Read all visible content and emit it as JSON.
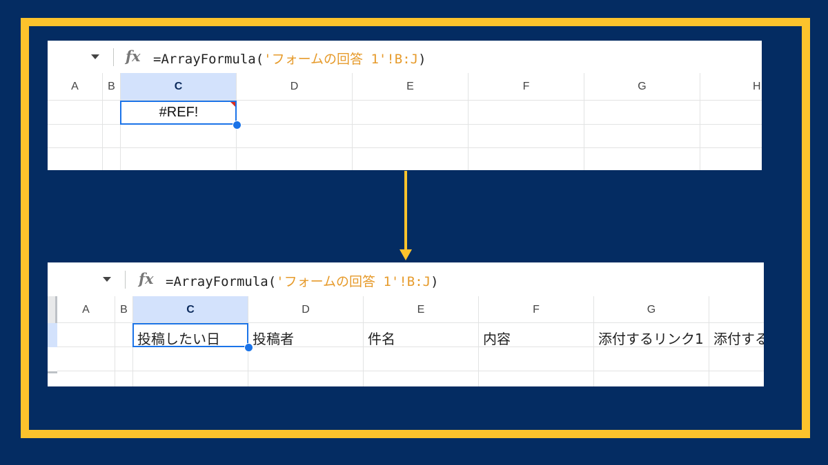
{
  "colors": {
    "background": "#042c62",
    "frame": "#fcc32c",
    "arrow": "#fcc32c",
    "selection": "#1a73e8",
    "selected_header": "#d3e2fc",
    "formula_ref": "#e69a2a",
    "error_corner": "#d93025"
  },
  "top": {
    "formula_prefix": "=ArrayFormula(",
    "formula_ref": "'フォームの回答 1'!B:J",
    "formula_suffix": ")",
    "fx_label": "fx",
    "columns": [
      "A",
      "B",
      "C",
      "D",
      "E",
      "F",
      "G",
      "H"
    ],
    "selected_column": "C",
    "cell_value": "#REF!"
  },
  "bottom": {
    "formula_prefix": "=ArrayFormula(",
    "formula_ref": "'フォームの回答 1'!B:J",
    "formula_suffix": ")",
    "fx_label": "fx",
    "columns": [
      "A",
      "B",
      "C",
      "D",
      "E",
      "F",
      "G"
    ],
    "selected_column": "C",
    "row_values": {
      "c": "投稿したい日",
      "d": "投稿者",
      "e": "件名",
      "f": "内容",
      "g": "添付するリンク1",
      "h": "添付する"
    }
  }
}
